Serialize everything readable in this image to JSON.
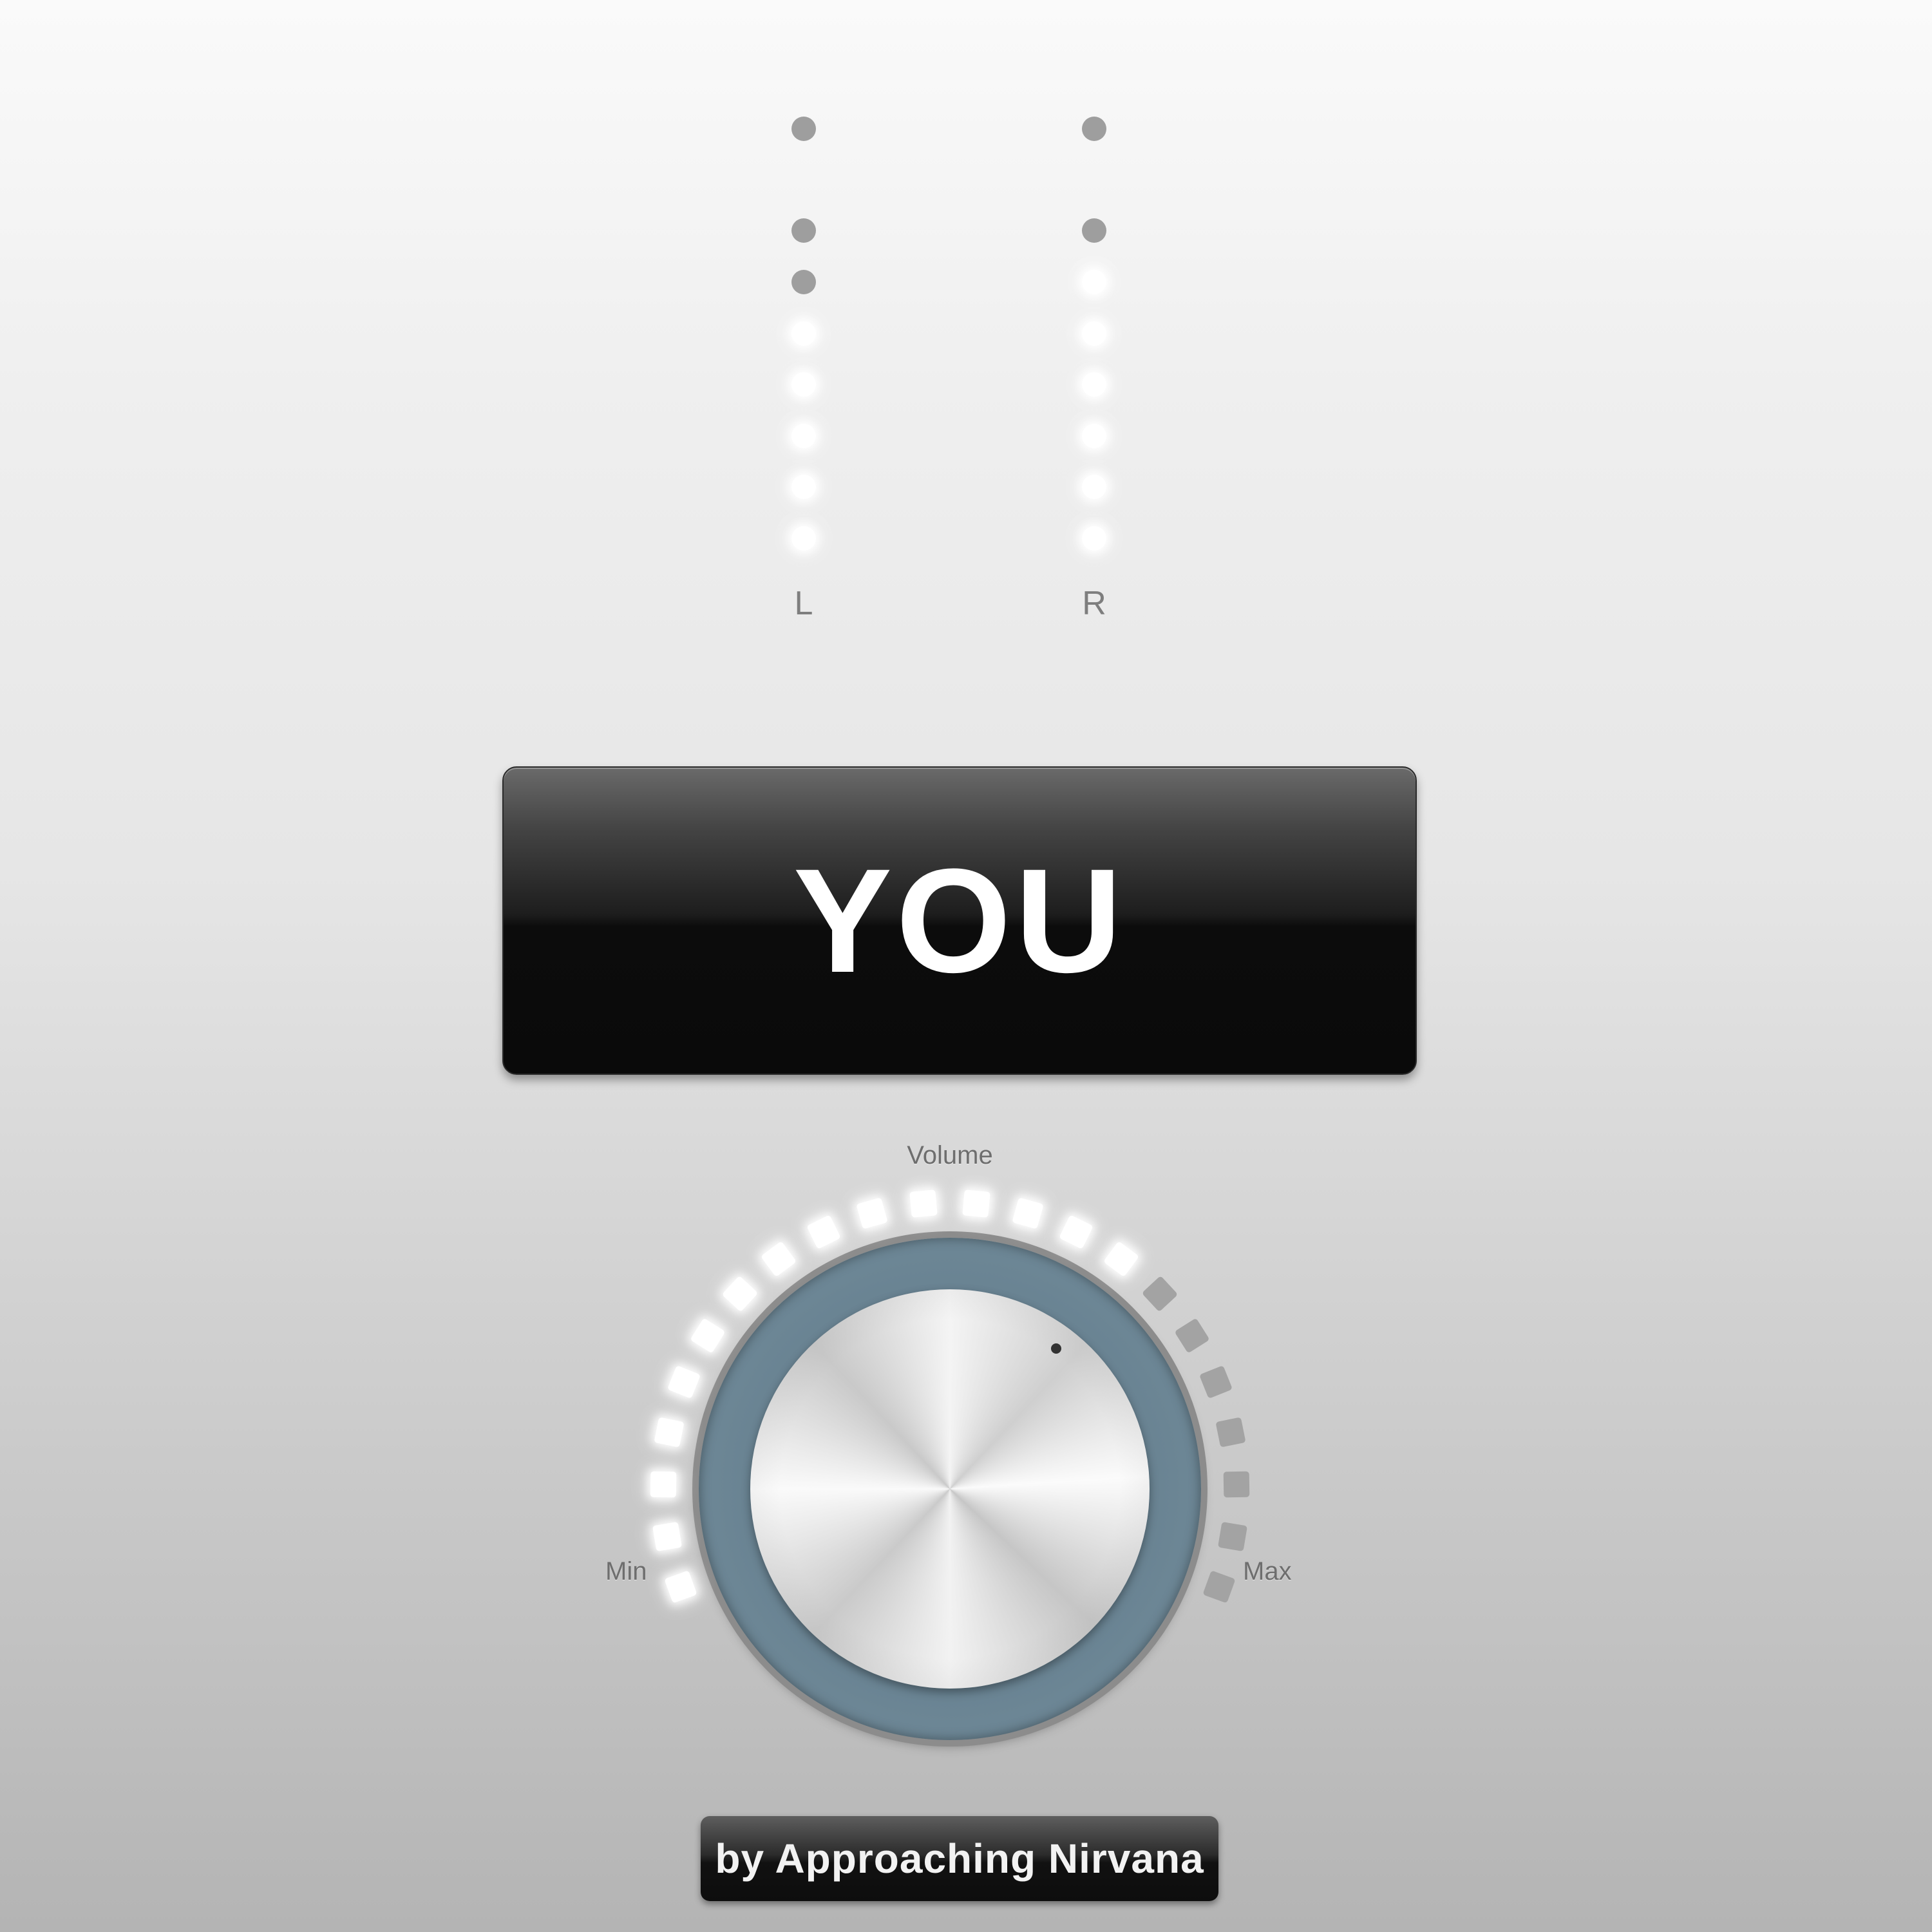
{
  "meters": {
    "left": {
      "label": "L",
      "leds_lit": 5,
      "leds_total": 9
    },
    "right": {
      "label": "R",
      "leds_lit": 6,
      "leds_total": 9
    }
  },
  "display": {
    "title": "YOU"
  },
  "volume": {
    "label": "Volume",
    "min_label": "Min",
    "max_label": "Max",
    "segments_total": 22,
    "segments_lit": 15,
    "level_fraction": 0.68
  },
  "credit": {
    "text": "by Approaching Nirvana"
  },
  "colors": {
    "led_on": "#ffffff",
    "led_off": "#9e9e9e",
    "display_bg": "#0c0c0c",
    "knob_ring": "#6d8796"
  }
}
